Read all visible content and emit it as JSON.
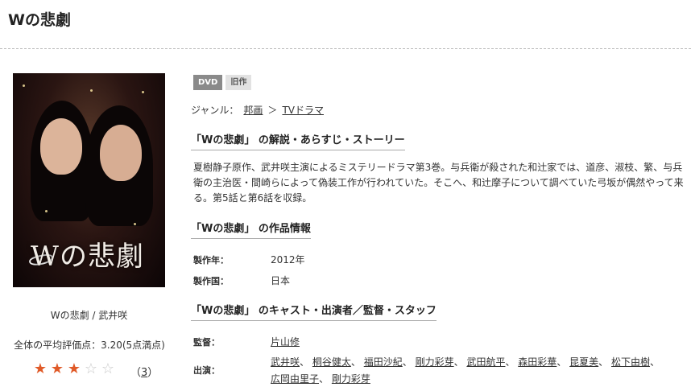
{
  "page": {
    "title": "Wの悲劇"
  },
  "poster": {
    "title_text": "Wの悲劇",
    "caption": "Wの悲劇 / 武井咲"
  },
  "rating": {
    "label": "全体の平均評価点：3.20(5点満点)",
    "value": 3.2,
    "max": 5,
    "count_open": "（",
    "count": "3",
    "count_close": "）"
  },
  "badges": {
    "format": "DVD",
    "status": "旧作"
  },
  "genre": {
    "label": "ジャンル：",
    "items": [
      "邦画",
      "TVドラマ"
    ],
    "separator": "＞"
  },
  "sections": {
    "synopsis_head": "「Wの悲劇」 の解説・あらすじ・ストーリー",
    "info_head": "「Wの悲劇」 の作品情報",
    "cast_head": "「Wの悲劇」 のキャスト・出演者／監督・スタッフ"
  },
  "synopsis": "夏樹静子原作、武井咲主演によるミステリードラマ第3巻。与兵衛が殺された和辻家では、道彦、淑枝、繁、与兵衛の主治医・間崎らによって偽装工作が行われていた。そこへ、和辻摩子について調べていた弓坂が偶然やって来る。第5話と第6話を収録。",
  "info": {
    "year_label": "製作年：",
    "year": "2012年",
    "country_label": "製作国：",
    "country": "日本"
  },
  "staff": {
    "director_label": "監督：",
    "director": "片山修",
    "cast_label": "出演：",
    "cast": [
      "武井咲",
      "桐谷健太",
      "福田沙紀",
      "剛力彩芽",
      "武田航平",
      "森田彩華",
      "昆夏美",
      "松下由樹",
      "広岡由里子",
      "剛力彩芽"
    ],
    "separator": "、"
  },
  "colors": {
    "star": "#e05a28",
    "dvd_badge": "#8a8a8a",
    "old_badge": "#e2e2e2"
  }
}
